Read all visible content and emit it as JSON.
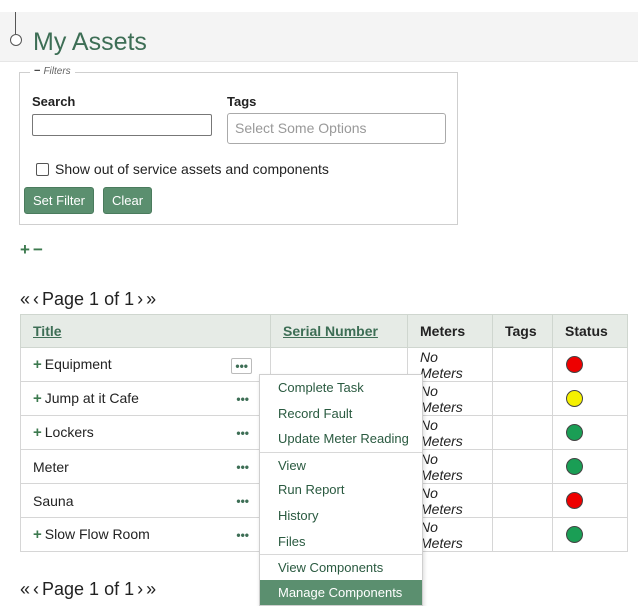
{
  "page": {
    "title": "My Assets"
  },
  "filters": {
    "legend": "Filters",
    "legend_icon": "minus-icon",
    "search_label": "Search",
    "search_value": "",
    "tags_label": "Tags",
    "tags_placeholder": "Select Some Options",
    "out_of_service_label": "Show out of service assets and components",
    "out_of_service_checked": false,
    "set_filter_label": "Set Filter",
    "clear_label": "Clear"
  },
  "expand_collapse": {
    "expand": "+",
    "collapse": "−"
  },
  "pager": {
    "first": "«",
    "prev": "‹",
    "text": "Page 1 of 1",
    "next": "›",
    "last": "»"
  },
  "table": {
    "headers": {
      "title": "Title",
      "serial": "Serial Number",
      "meters": "Meters",
      "tags": "Tags",
      "status": "Status"
    },
    "rows": [
      {
        "title": "Equipment",
        "expandable": true,
        "serial": "",
        "meters": "No Meters",
        "tags": "",
        "status": "red",
        "status_color": "#ee0000"
      },
      {
        "title": "Jump at it Cafe",
        "expandable": true,
        "serial": "",
        "meters": "No Meters",
        "tags": "",
        "status": "yellow",
        "status_color": "#f5f000"
      },
      {
        "title": "Lockers",
        "expandable": true,
        "serial": "",
        "meters": "No Meters",
        "tags": "",
        "status": "green",
        "status_color": "#1a9e55"
      },
      {
        "title": "Meter",
        "expandable": false,
        "serial": "",
        "meters": "No Meters",
        "tags": "",
        "status": "green",
        "status_color": "#1a9e55"
      },
      {
        "title": "Sauna",
        "expandable": false,
        "serial": "",
        "meters": "No Meters",
        "tags": "",
        "status": "red",
        "status_color": "#ee0000"
      },
      {
        "title": "Slow Flow Room",
        "expandable": true,
        "serial": "",
        "meters": "No Meters",
        "tags": "",
        "status": "green",
        "status_color": "#1a9e55"
      }
    ],
    "more_label": "•••"
  },
  "context_menu": {
    "items": [
      {
        "label": "Complete Task"
      },
      {
        "label": "Record Fault"
      },
      {
        "label": "Update Meter Reading"
      },
      {
        "label": "View"
      },
      {
        "label": "Run Report"
      },
      {
        "label": "History"
      },
      {
        "label": "Files"
      },
      {
        "label": "View Components"
      },
      {
        "label": "Manage Components"
      }
    ]
  },
  "colors": {
    "accent": "#5b8f6f",
    "title": "#3d6e55",
    "header_bg": "#e6ebe6"
  }
}
